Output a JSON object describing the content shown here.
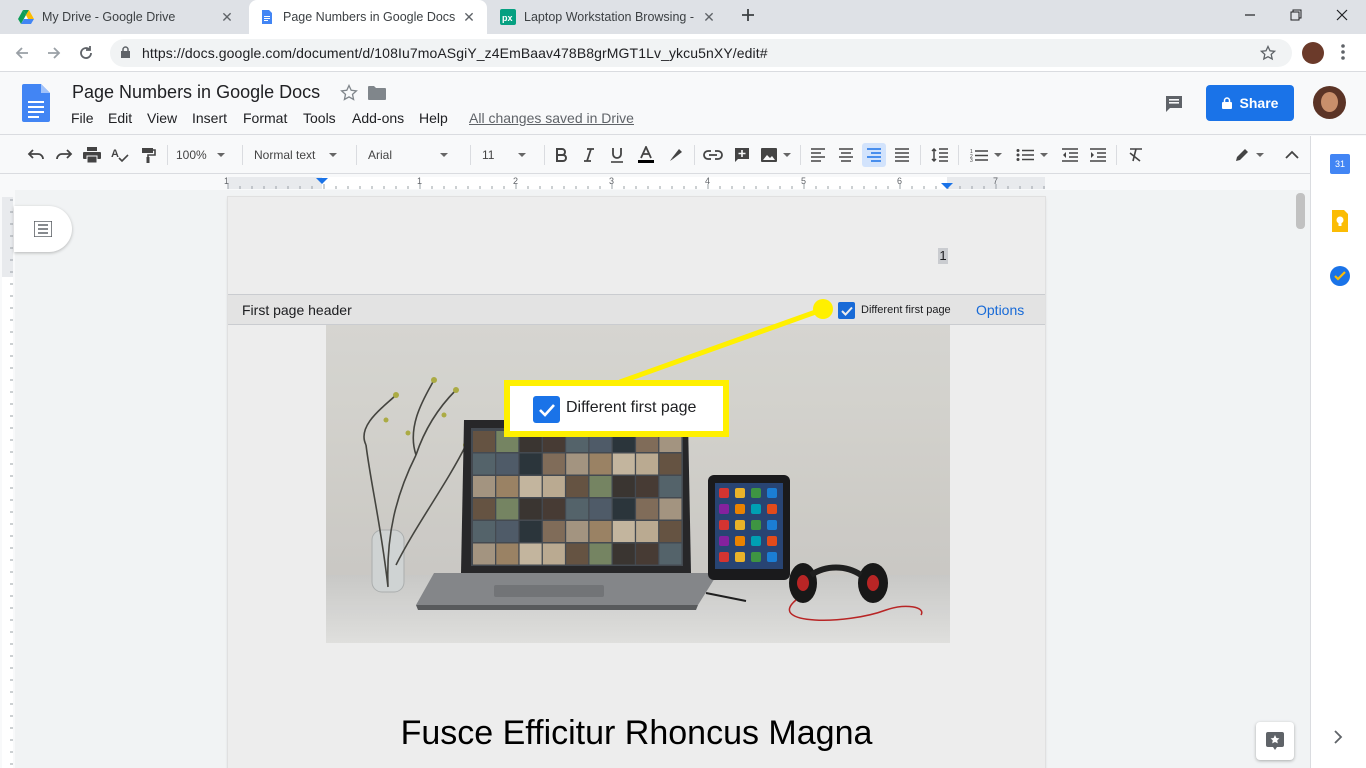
{
  "browser": {
    "tabs": [
      {
        "title": "My Drive - Google Drive"
      },
      {
        "title": "Page Numbers in Google Docs -"
      },
      {
        "title": "Laptop Workstation Browsing - F"
      }
    ],
    "url": "https://docs.google.com/document/d/108Iu7moASgiY_z4EmBaav478B8grMGT1Lv_ykcu5nXY/edit#"
  },
  "docs": {
    "title": "Page Numbers in Google Docs",
    "menus": [
      "File",
      "Edit",
      "View",
      "Insert",
      "Format",
      "Tools",
      "Add-ons",
      "Help"
    ],
    "saved_status": "All changes saved in Drive",
    "share_label": "Share"
  },
  "toolbar": {
    "zoom": "100%",
    "style": "Normal text",
    "font": "Arial",
    "font_size": "11"
  },
  "ruler": {
    "labels": [
      "1",
      "1",
      "2",
      "3",
      "4",
      "5",
      "6",
      "7"
    ]
  },
  "page": {
    "header_number": "1",
    "header_bar_label": "First page header",
    "different_first_page_label": "Different first page",
    "different_first_page_checked": true,
    "options_label": "Options",
    "heading": "Fusce Efficitur Rhoncus Magna"
  },
  "callout": {
    "label": "Different first page",
    "color": "#fff000"
  },
  "colors": {
    "accent": "#1a73e8",
    "highlight": "#fff000"
  }
}
